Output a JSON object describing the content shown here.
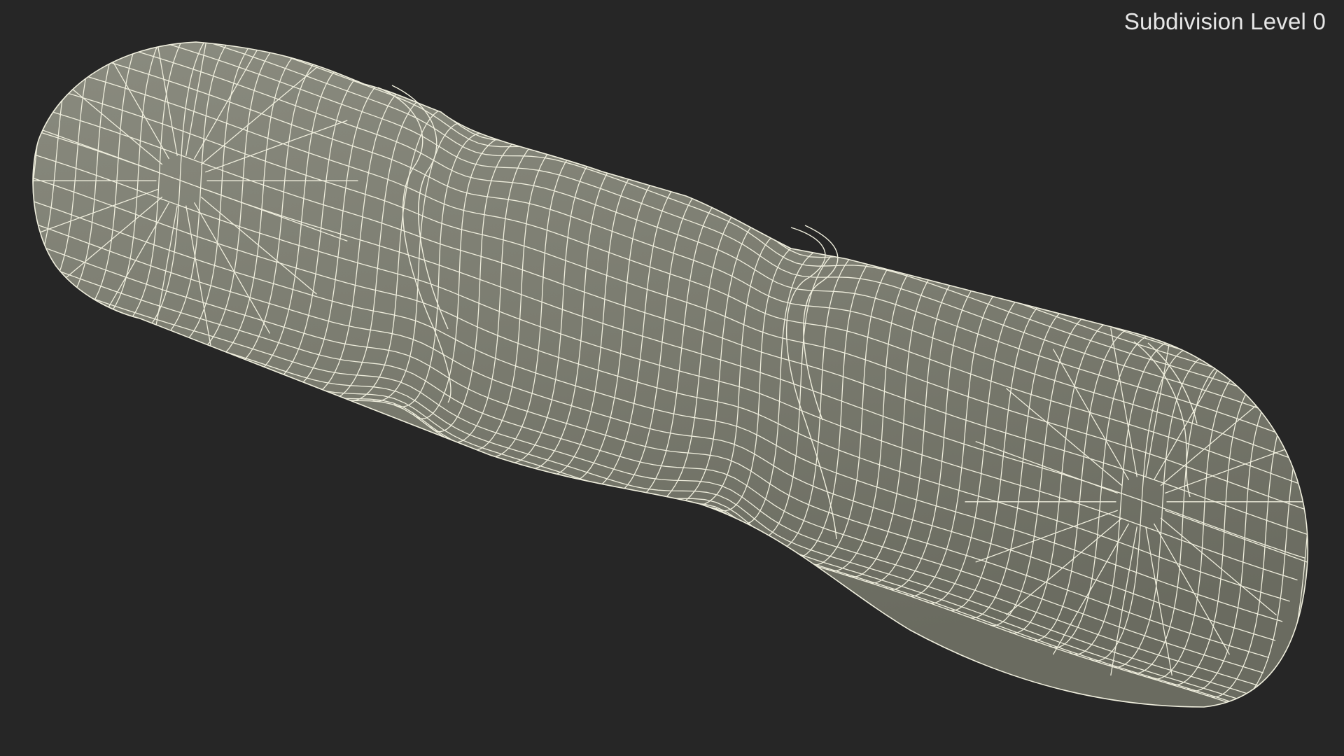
{
  "viewport": {
    "subdivision_label": "Subdivision Level 0",
    "background_color": "#262626",
    "object_color": "#7c7d71",
    "wire_color": "#efeedd"
  }
}
